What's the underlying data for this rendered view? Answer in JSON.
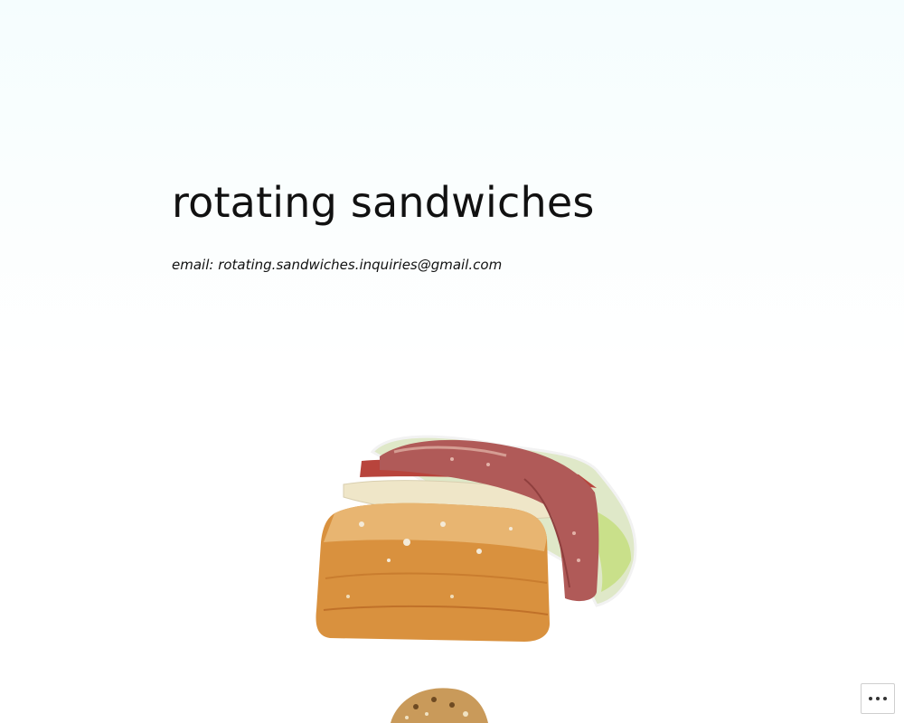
{
  "site": {
    "title": "rotating sandwiches",
    "email_line": "email: rotating.sandwiches.inquiries@gmail.com"
  },
  "media": {
    "primary_image": "sandwich-image",
    "secondary_image": "sandwich-image"
  },
  "controls": {
    "more_icon": "ellipsis-icon"
  }
}
